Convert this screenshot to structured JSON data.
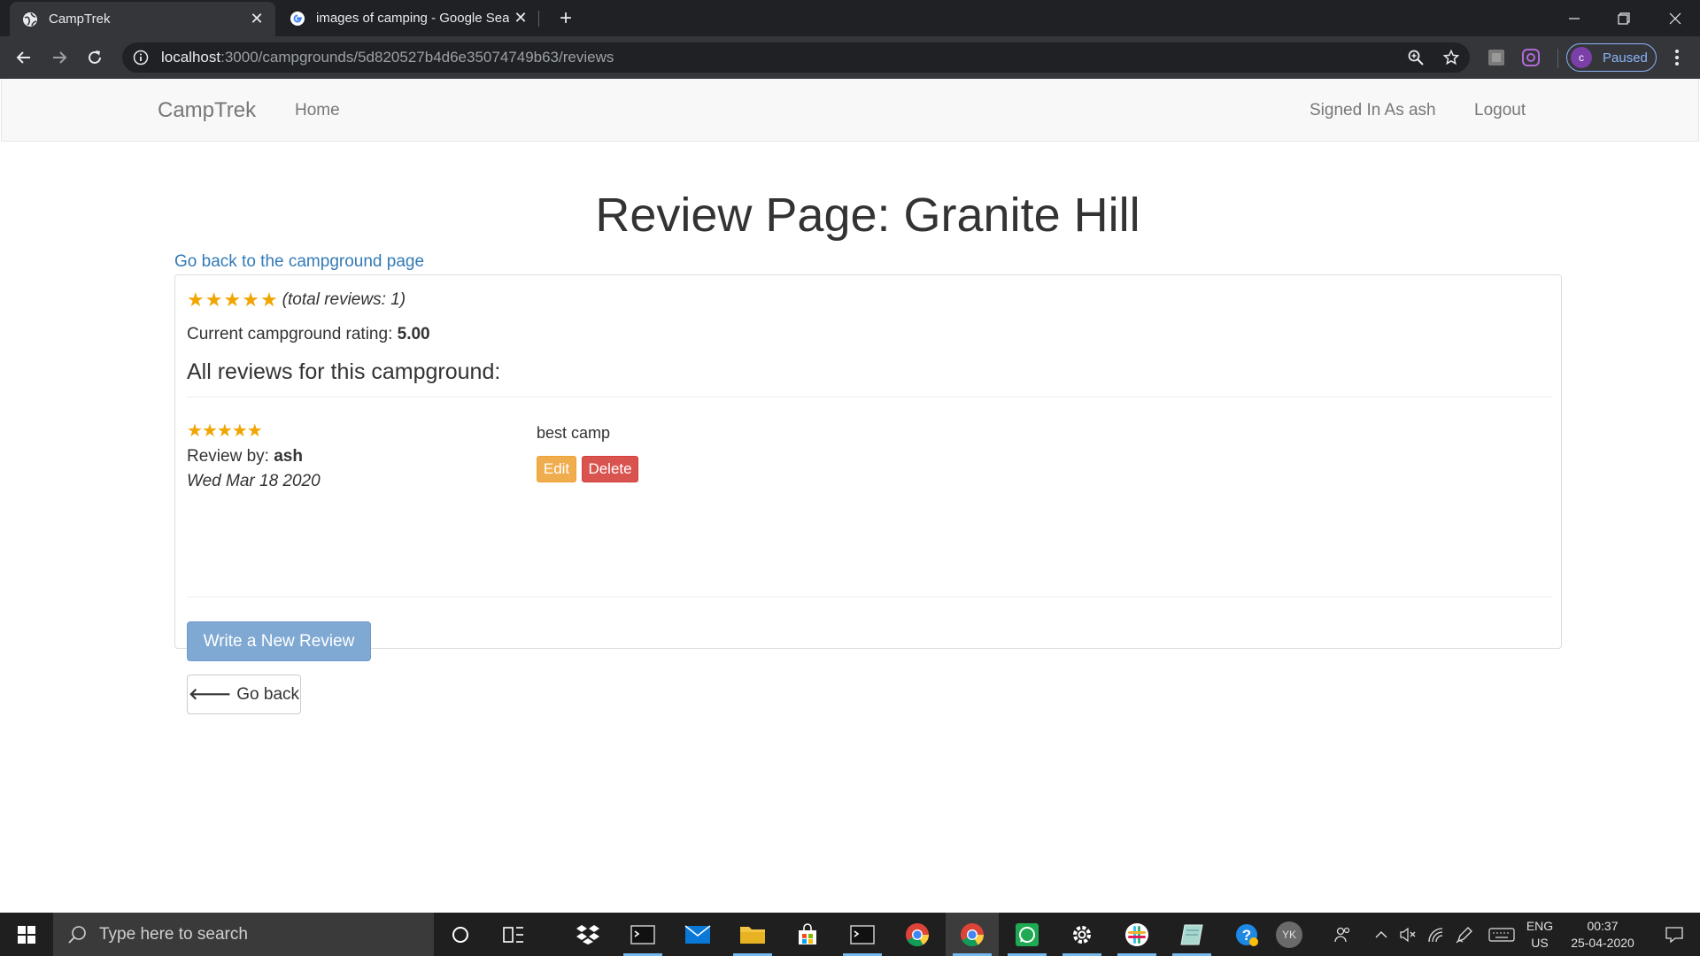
{
  "browser": {
    "tabs": [
      {
        "title": "CampTrek",
        "active": true
      },
      {
        "title": "images of camping - Google Sea",
        "active": false
      }
    ],
    "url_host": "localhost",
    "url_rest": ":3000/campgrounds/5d820527b4d6e35074749b63/reviews",
    "profile_initial": "c",
    "profile_status": "Paused"
  },
  "navbar": {
    "brand": "CampTrek",
    "home": "Home",
    "signed_in": "Signed In As ash",
    "logout": "Logout"
  },
  "main": {
    "title": "Review Page: Granite Hill",
    "back_link": "Go back to the campground page",
    "total_reviews": "(total reviews: 1)",
    "rating_label": "Current campground rating: ",
    "rating_value": "5.00",
    "all_reviews_heading": "All reviews for this campground:",
    "overall_stars": 5,
    "review": {
      "stars": 5,
      "by_label": "Review by: ",
      "author": "ash",
      "date": "Wed Mar 18 2020",
      "text": "best camp",
      "edit_label": "Edit",
      "delete_label": "Delete"
    },
    "write_review": "Write a New Review",
    "go_back": "Go back"
  },
  "taskbar": {
    "search_placeholder": "Type here to search",
    "lang_line1": "ENG",
    "lang_line2": "US",
    "time": "00:37",
    "date": "25-04-2020",
    "user_initials": "YK"
  },
  "colors": {
    "star": "#f0a500",
    "link": "#337ab7",
    "edit": "#f0ad4e",
    "delete": "#d9534f",
    "primary_disabled": "#7fa9d3"
  }
}
